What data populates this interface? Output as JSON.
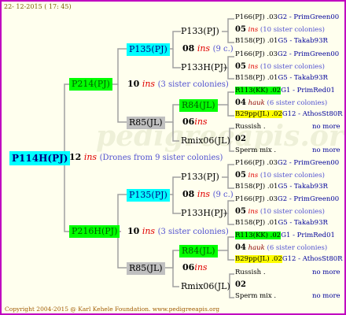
{
  "date": "22- 12-2015 ( 17: 45)",
  "copyright": "Copyright 2004-2015 @ Karl Kehele Foundation.   www.pedigreeapis.org",
  "root": {
    "name": "P114H(PJ)",
    "year": "12",
    "ins": "ins",
    "note": "(Drones from 9 sister colonies)"
  },
  "gen2": {
    "top": {
      "name": "P214(PJ)",
      "year": "10",
      "ins": "ins",
      "note": "(3 sister colonies)"
    },
    "bottom": {
      "name": "P216H(PJ)",
      "year": "10",
      "ins": "ins",
      "note": "(3 sister colonies)"
    }
  },
  "gen3": [
    {
      "name": "P135(PJ)",
      "year": "08",
      "ins": "ins",
      "note": "(9 c.)"
    },
    {
      "name": "R85(JL)",
      "year": "06",
      "ins": "ins",
      "note": ""
    },
    {
      "name": "P135(PJ)",
      "year": "08",
      "ins": "ins",
      "note": "(9 c.)"
    },
    {
      "name": "R85(JL)",
      "year": "06",
      "ins": "ins",
      "note": ""
    }
  ],
  "gen4": [
    {
      "name": "P133(PJ)",
      "year": "",
      "ins": "",
      "note": ""
    },
    {
      "name": "P133H(PJ)",
      "year": "",
      "ins": "",
      "note": ""
    },
    {
      "name": "R84(JL)",
      "year": "",
      "ins": "",
      "note": ""
    },
    {
      "name": "Rmix06(JL)",
      "year": "",
      "ins": "",
      "note": ""
    },
    {
      "name": "P133(PJ)",
      "year": "",
      "ins": "",
      "note": ""
    },
    {
      "name": "P133H(PJ)",
      "year": "",
      "ins": "",
      "note": ""
    },
    {
      "name": "R84(JL)",
      "year": "",
      "ins": "",
      "note": ""
    },
    {
      "name": "Rmix06(JL)",
      "year": "",
      "ins": "",
      "note": ""
    }
  ],
  "gen5_blocks": [
    {
      "rows": [
        {
          "name": "P166(PJ) .03",
          "link": "G2 - PrimGreen00",
          "highlight": ""
        },
        {
          "name": "05",
          "ins": "ins",
          "note": "(10 sister colonies)",
          "highlight": ""
        },
        {
          "name": "B158(PJ) .01",
          "link": "G5 - Takab93R",
          "highlight": ""
        }
      ]
    },
    {
      "rows": [
        {
          "name": "P166(PJ) .03",
          "link": "G2 - PrimGreen00",
          "highlight": ""
        },
        {
          "name": "05",
          "ins": "ins",
          "note": "(10 sister colonies)",
          "highlight": ""
        },
        {
          "name": "B158(PJ) .01",
          "link": "G5 - Takab93R",
          "highlight": ""
        }
      ]
    },
    {
      "rows": [
        {
          "name": "R113(KK) .02",
          "link": "G1 - PrimRed01",
          "highlight": "green"
        },
        {
          "name": "04",
          "ins": "hauk",
          "note": "(6 sister colonies)",
          "highlight": ""
        },
        {
          "name": "B29pp(JL) .02",
          "link": "G12 - AthosSt80R",
          "highlight": "yellow"
        }
      ]
    },
    {
      "rows": [
        {
          "name": "Russish .",
          "link": "no more",
          "highlight": ""
        },
        {
          "name": "02",
          "ins": "",
          "note": "",
          "highlight": ""
        },
        {
          "name": "Sperm mix .",
          "link": "no more",
          "highlight": ""
        }
      ]
    },
    {
      "rows": [
        {
          "name": "P166(PJ) .03",
          "link": "G2 - PrimGreen00",
          "highlight": ""
        },
        {
          "name": "05",
          "ins": "ins",
          "note": "(10 sister colonies)",
          "highlight": ""
        },
        {
          "name": "B158(PJ) .01",
          "link": "G5 - Takab93R",
          "highlight": ""
        }
      ]
    },
    {
      "rows": [
        {
          "name": "P166(PJ) .03",
          "link": "G2 - PrimGreen00",
          "highlight": ""
        },
        {
          "name": "05",
          "ins": "ins",
          "note": "(10 sister colonies)",
          "highlight": ""
        },
        {
          "name": "B158(PJ) .01",
          "link": "G5 - Takab93R",
          "highlight": ""
        }
      ]
    },
    {
      "rows": [
        {
          "name": "R113(KK) .02",
          "link": "G1 - PrimRed01",
          "highlight": "green"
        },
        {
          "name": "04",
          "ins": "hauk",
          "note": "(6 sister colonies)",
          "highlight": ""
        },
        {
          "name": "B29pp(JL) .02",
          "link": "G12 - AthosSt80R",
          "highlight": "yellow"
        }
      ]
    },
    {
      "rows": [
        {
          "name": "Russish .",
          "link": "no more",
          "highlight": ""
        },
        {
          "name": "02",
          "ins": "",
          "note": "",
          "highlight": ""
        },
        {
          "name": "Sperm mix .",
          "link": "no more",
          "highlight": ""
        }
      ]
    }
  ]
}
